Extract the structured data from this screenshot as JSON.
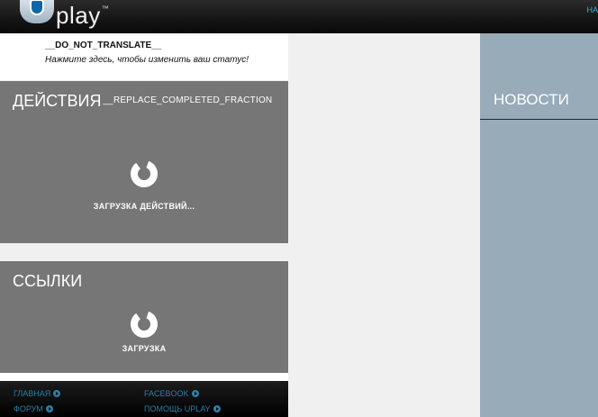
{
  "header": {
    "logo_text": "play",
    "logo_tm": "™",
    "nav_partial": "НА"
  },
  "status": {
    "username": "__DO_NOT_TRANSLATE__",
    "prompt": "Нажмите здесь, чтобы изменить ваш статус!"
  },
  "activities": {
    "title": "ДЕЙСТВИЯ",
    "title_suffix": "__REPLACE_COMPLETED_FRACTION",
    "loading_label": "ЗАГРУЗКА ДЕЙСТВИЙ..."
  },
  "links": {
    "title": "ССЫЛКИ",
    "loading_label": "ЗАГРУЗКА"
  },
  "footer": {
    "links": [
      {
        "label": "ГЛАВНАЯ"
      },
      {
        "label": "FACEBOOK"
      },
      {
        "label": "ФОРУМ"
      },
      {
        "label": "ПОМОЩЬ UPLAY"
      }
    ]
  },
  "news": {
    "title": "НОВОСТИ"
  },
  "colors": {
    "header_bg": "#151515",
    "panel_bg": "#767676",
    "news_bg": "#97abb8",
    "link_blue": "#2b7fa8"
  },
  "icons": [
    "uplay-logo-icon",
    "loading-spinner-icon",
    "arrow-circle-icon"
  ]
}
